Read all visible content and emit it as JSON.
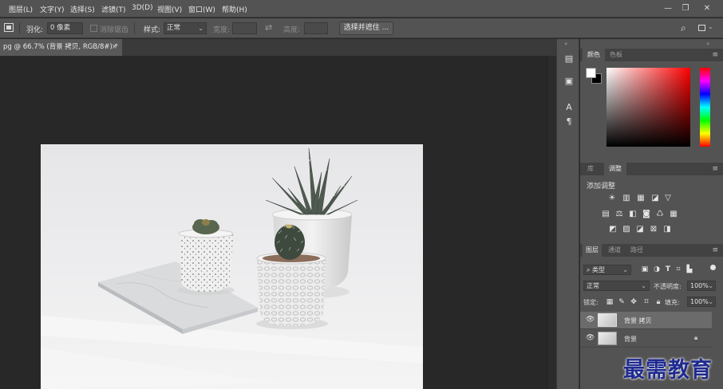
{
  "menubar": {
    "items": [
      "图层(L)",
      "文字(Y)",
      "选择(S)",
      "滤镜(T)",
      "3D(D)",
      "视图(V)",
      "窗口(W)",
      "帮助(H)"
    ]
  },
  "options": {
    "feather_label": "羽化:",
    "feather_value": "0 像素",
    "antialias_label": "消除锯齿",
    "style_label": "样式:",
    "style_value": "正常",
    "width_label": "宽度:",
    "height_label": "高度:",
    "select_mask_button": "选择并遮住 ..."
  },
  "document": {
    "tab_title": "pg @ 66.7% (背景 拷贝, RGB/8#) *",
    "close_glyph": "×"
  },
  "color_panel": {
    "tabs": [
      "颜色",
      "色板"
    ],
    "colors": {
      "foreground": "#ffffff",
      "background": "#000000",
      "hue": "#ff0000"
    }
  },
  "adjust_panel": {
    "tabs": [
      "库",
      "调整"
    ],
    "title": "添加调整"
  },
  "layers_panel": {
    "tabs": [
      "图层",
      "通道",
      "路径"
    ],
    "filter_value": "类型",
    "blend_mode": "正常",
    "opacity_label": "不透明度:",
    "opacity_value": "100%",
    "lock_label": "锁定:",
    "fill_label": "填充:",
    "fill_value": "100%",
    "layers": [
      {
        "name": "背景 拷贝",
        "selected": true
      },
      {
        "name": "背景",
        "selected": false
      }
    ]
  },
  "watermark": "最需教育"
}
